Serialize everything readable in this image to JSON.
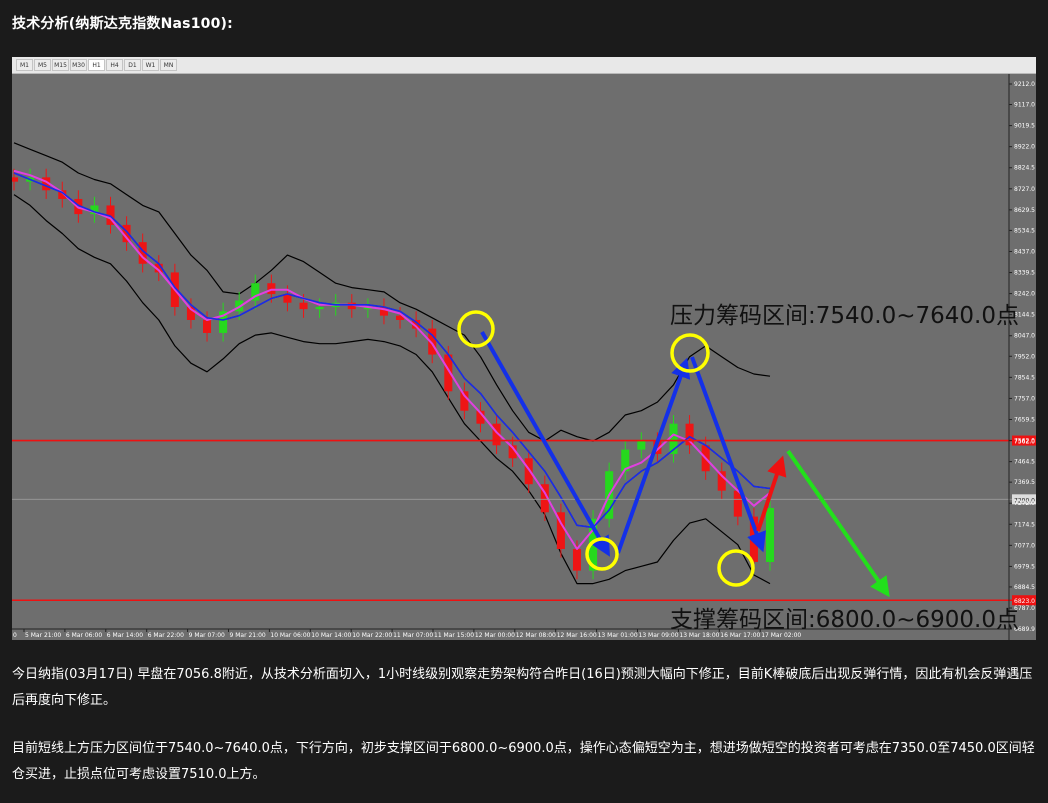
{
  "heading": "技术分析(纳斯达克指数Nas100):",
  "timeframes": [
    "M1",
    "M5",
    "M15",
    "M30",
    "H1",
    "H4",
    "D1",
    "W1",
    "MN"
  ],
  "active_timeframe": "H1",
  "colors": {
    "background": "#1b1b1b",
    "chart_bg": "#6e6e6e",
    "line_red": "#ee1111",
    "arrow_blue": "#1430e8",
    "arrow_green": "#22e01b",
    "arrow_red": "#ee1111",
    "circle": "#ffff00",
    "candle_up": "#26d81e",
    "candle_down": "#ee1515"
  },
  "chart_data": {
    "type": "line",
    "title": "",
    "xlabel": "",
    "ylabel": "",
    "ylim": [
      6689.9,
      9212.0
    ],
    "y_ticks": [
      "9212.0",
      "9117.0",
      "9019.5",
      "8922.0",
      "8824.5",
      "8727.0",
      "8629.5",
      "8534.5",
      "8437.0",
      "8339.5",
      "8242.0",
      "8144.5",
      "8047.0",
      "7952.0",
      "7854.5",
      "7757.0",
      "7659.5",
      "7562.0",
      "7464.5",
      "7369.5",
      "7272.0",
      "7174.5",
      "7077.0",
      "6979.5",
      "6884.5",
      "6787.0",
      "6689.9"
    ],
    "x_ticks": [
      "5 Mar 21:00",
      "6 Mar 06:00",
      "6 Mar 14:00",
      "6 Mar 22:00",
      "9 Mar 07:00",
      "9 Mar 21:00",
      "10 Mar 06:00",
      "10 Mar 14:00",
      "10 Mar 22:00",
      "11 Mar 07:00",
      "11 Mar 15:00",
      "12 Mar 00:00",
      "12 Mar 08:00",
      "12 Mar 16:00",
      "13 Mar 01:00",
      "13 Mar 09:00",
      "13 Mar 18:00",
      "16 Mar 17:00",
      "17 Mar 02:00"
    ],
    "x_first_label": "0",
    "current_price_label": "7290.0",
    "resistance_line": {
      "value": 7562.0,
      "label": "7562.0"
    },
    "support_line": {
      "value": 6823.0,
      "label": "6823.0"
    },
    "annotations": {
      "resistance": "压力筹码区间:7540.0~7640.0点",
      "support": "支撑筹码区间:6800.0~6900.0点"
    },
    "bollinger_upper": [
      8940,
      8910,
      8880,
      8850,
      8800,
      8770,
      8750,
      8700,
      8650,
      8620,
      8520,
      8420,
      8350,
      8250,
      8240,
      8290,
      8350,
      8420,
      8390,
      8340,
      8290,
      8270,
      8260,
      8250,
      8200,
      8170,
      8130,
      8090,
      8050,
      7950,
      7820,
      7700,
      7600,
      7560,
      7610,
      7580,
      7560,
      7600,
      7680,
      7700,
      7740,
      7820,
      7950,
      8000,
      7950,
      7900,
      7870,
      7860
    ],
    "bollinger_lower": [
      8700,
      8650,
      8580,
      8520,
      8450,
      8410,
      8380,
      8300,
      8200,
      8120,
      8000,
      7920,
      7880,
      7940,
      8010,
      8050,
      8060,
      8040,
      8020,
      8010,
      8010,
      8020,
      8030,
      8020,
      8000,
      7960,
      7880,
      7760,
      7640,
      7560,
      7480,
      7420,
      7330,
      7220,
      7040,
      6900,
      6900,
      6920,
      6960,
      6980,
      7000,
      7100,
      7180,
      7200,
      7140,
      7080,
      6940,
      6900
    ],
    "sma": [
      8800,
      8770,
      8740,
      8710,
      8650,
      8620,
      8600,
      8530,
      8440,
      8380,
      8270,
      8190,
      8130,
      8120,
      8140,
      8180,
      8220,
      8240,
      8220,
      8200,
      8190,
      8190,
      8190,
      8180,
      8160,
      8110,
      8050,
      7960,
      7850,
      7780,
      7680,
      7600,
      7510,
      7420,
      7300,
      7170,
      7160,
      7240,
      7360,
      7420,
      7460,
      7520,
      7580,
      7540,
      7480,
      7420,
      7350,
      7340
    ],
    "ema": [
      8810,
      8790,
      8760,
      8710,
      8640,
      8620,
      8590,
      8500,
      8410,
      8350,
      8260,
      8170,
      8120,
      8140,
      8180,
      8230,
      8260,
      8260,
      8220,
      8190,
      8190,
      8190,
      8180,
      8170,
      8150,
      8090,
      8010,
      7890,
      7770,
      7690,
      7600,
      7530,
      7430,
      7320,
      7180,
      7060,
      7150,
      7310,
      7430,
      7460,
      7520,
      7590,
      7560,
      7480,
      7400,
      7330,
      7260,
      7320
    ],
    "close": [
      8760,
      8780,
      8720,
      8680,
      8610,
      8650,
      8560,
      8480,
      8380,
      8340,
      8180,
      8120,
      8060,
      8160,
      8210,
      8290,
      8240,
      8200,
      8170,
      8180,
      8200,
      8170,
      8180,
      8140,
      8120,
      8080,
      7960,
      7790,
      7700,
      7640,
      7540,
      7480,
      7360,
      7230,
      7060,
      6960,
      7200,
      7420,
      7520,
      7560,
      7500,
      7640,
      7540,
      7420,
      7330,
      7210,
      7000,
      7250
    ]
  },
  "paragraph1": "今日纳指(03月17日) 早盘在7056.8附近，从技术分析面切入，1小时线级别观察走势架构符合昨日(16日)预测大幅向下修正，目前K棒破底后出现反弹行情，因此有机会反弹遇压后再度向下修正。",
  "paragraph2": "目前短线上方压力区间位于7540.0~7640.0点，下行方向，初步支撑区间于6800.0~6900.0点，操作心态偏短空为主，想进场做短空的投资者可考虑在7350.0至7450.0区间轻仓买进，止损点位可考虑设置7510.0上方。"
}
